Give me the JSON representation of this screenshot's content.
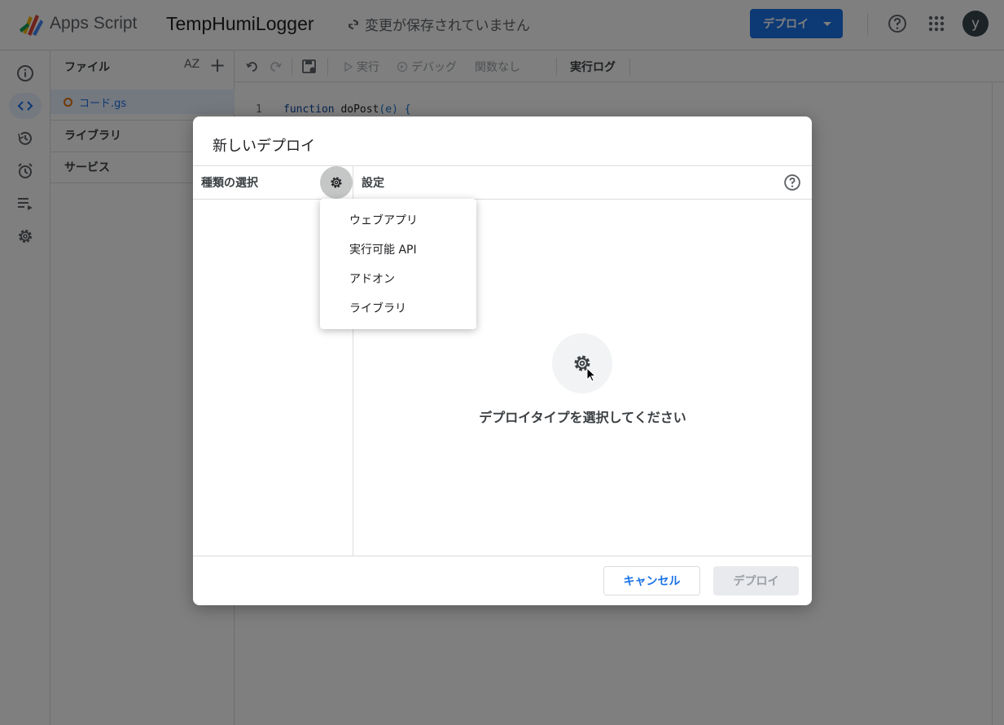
{
  "header": {
    "app_name": "Apps Script",
    "project_title": "TempHumiLogger",
    "save_status": "変更が保存されていません",
    "deploy_label": "デプロイ",
    "avatar_initial": "y"
  },
  "rail": {
    "items": [
      {
        "icon": "info-icon",
        "active": false
      },
      {
        "icon": "code-icon",
        "active": true
      },
      {
        "icon": "history-icon",
        "active": false
      },
      {
        "icon": "alarm-icon",
        "active": false
      },
      {
        "icon": "executions-icon",
        "active": false
      },
      {
        "icon": "settings-gear-icon",
        "active": false
      }
    ]
  },
  "files": {
    "heading": "ファイル",
    "sort_label": "AZ",
    "items": [
      {
        "name": "コード.gs"
      }
    ],
    "libraries_label": "ライブラリ",
    "services_label": "サービス"
  },
  "toolbar": {
    "run_label": "実行",
    "debug_label": "デバッグ",
    "function_label": "関数なし",
    "log_label": "実行ログ"
  },
  "editor": {
    "line_number": "1",
    "code_keyword": "function",
    "code_name": "doPost",
    "code_rest": "(e) {"
  },
  "dialog": {
    "title": "新しいデプロイ",
    "type_label": "種類の選択",
    "settings_label": "設定",
    "empty_message": "デプロイタイプを選択してください",
    "cancel_label": "キャンセル",
    "deploy_label": "デプロイ"
  },
  "type_menu": {
    "items": [
      {
        "label": "ウェブアプリ"
      },
      {
        "label": "実行可能 API"
      },
      {
        "label": "アドオン"
      },
      {
        "label": "ライブラリ"
      }
    ]
  },
  "colors": {
    "accent": "#1a73e8",
    "active_bg": "#e8f0fe",
    "scrim": "#00000080",
    "modified_dot": "#e37400"
  }
}
